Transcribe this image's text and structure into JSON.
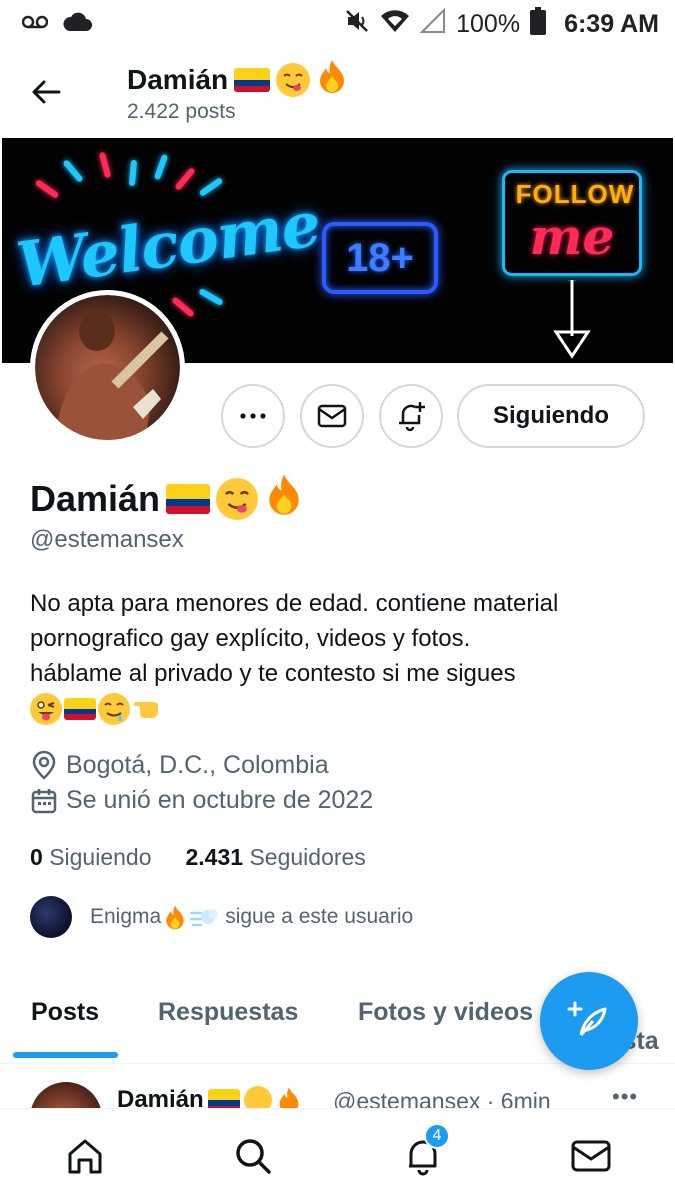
{
  "status_bar": {
    "battery": "100%",
    "time": "6:39 AM"
  },
  "header": {
    "name": "Damián",
    "posts_count": "2.422 posts"
  },
  "banner": {
    "welcome": "Welcome",
    "age": "18+",
    "follow": "FOLLOW",
    "me": "me"
  },
  "actions": {
    "following_label": "Siguiendo"
  },
  "profile": {
    "name": "Damián",
    "handle": "@estemansex",
    "bio_line1": "No apta para menores de edad. contiene material",
    "bio_line2": "pornografico gay explícito, videos y fotos.",
    "bio_line3": "háblame al privado y te contesto si me sigues",
    "location": "Bogotá, D.C., Colombia",
    "joined": "Se unió en octubre de 2022",
    "following_count": "0",
    "following_label": "Siguiendo",
    "followers_count": "2.431",
    "followers_label": "Seguidores",
    "known_follower_name": "Enigma",
    "known_follower_text": "sigue a este usuario"
  },
  "tabs": [
    {
      "label": "Posts"
    },
    {
      "label": "Respuestas"
    },
    {
      "label": "Fotos y videos"
    },
    {
      "label": "Me gusta"
    }
  ],
  "post_preview": {
    "name": "Damián",
    "handle_time": "@estemansex · 6min",
    "more": "•••"
  },
  "bottom_nav": {
    "notifications_badge": "4"
  },
  "colors": {
    "accent": "#1d9bf0",
    "secondary_text": "#536471",
    "border": "#cfd9de"
  }
}
